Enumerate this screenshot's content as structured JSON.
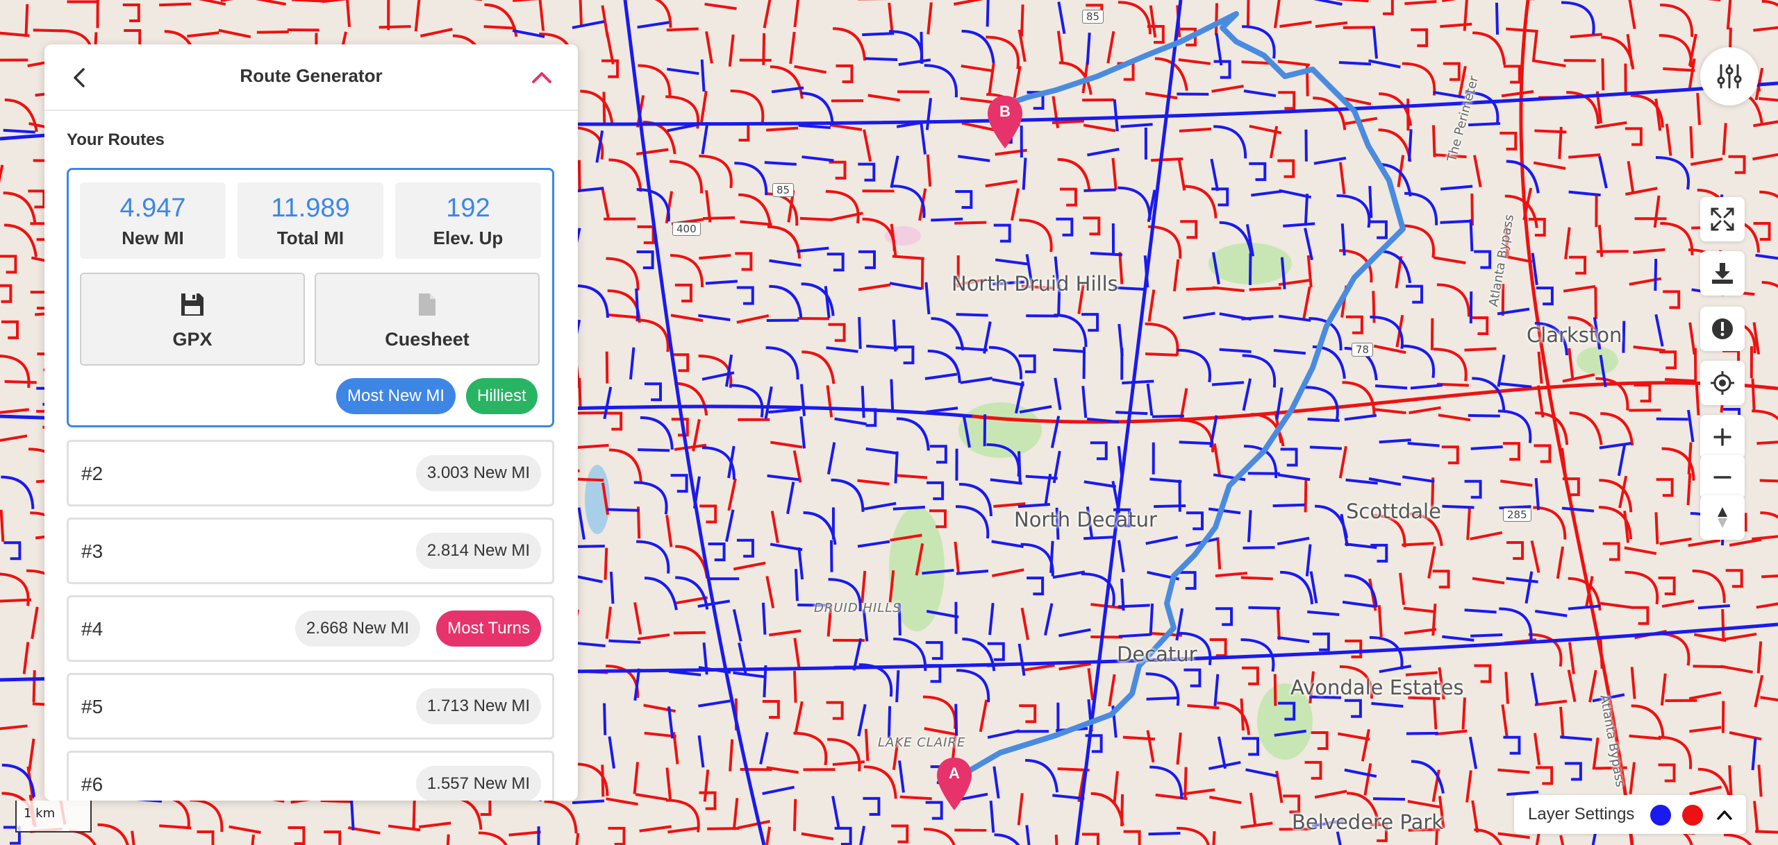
{
  "panel": {
    "title": "Route Generator",
    "routes_heading": "Your Routes",
    "selected_route": {
      "stats": [
        {
          "value": "4.947",
          "label": "New MI"
        },
        {
          "value": "11.989",
          "label": "Total MI"
        },
        {
          "value": "192",
          "label": "Elev. Up"
        }
      ],
      "gpx_label": "GPX",
      "cuesheet_label": "Cuesheet",
      "tags": [
        "Most New MI",
        "Hilliest"
      ]
    },
    "routes": [
      {
        "num": "#2",
        "new_mi": "3.003 New MI",
        "tag": ""
      },
      {
        "num": "#3",
        "new_mi": "2.814 New MI",
        "tag": ""
      },
      {
        "num": "#4",
        "new_mi": "2.668 New MI",
        "tag": "Most Turns"
      },
      {
        "num": "#5",
        "new_mi": "1.713 New MI",
        "tag": ""
      },
      {
        "num": "#6",
        "new_mi": "1.557 New MI",
        "tag": ""
      }
    ]
  },
  "map": {
    "places": [
      "North Druid Hills",
      "North Decatur",
      "Decatur",
      "Scottdale",
      "Clarkston",
      "Avondale Estates",
      "Belvedere Park"
    ],
    "small_places": [
      "DRUID HILLS",
      "LAKE CLAIRE"
    ],
    "roads": [
      "The Perimeter",
      "Atlanta Bypass",
      "Atlanta Bypass"
    ],
    "shields": [
      "85",
      "85",
      "400",
      "78",
      "285"
    ],
    "marker_a": "A",
    "marker_b": "B",
    "scale": "1 km"
  },
  "layer_settings": {
    "label": "Layer Settings"
  },
  "colors": {
    "accent_blue": "#3d86e6",
    "green": "#28b463",
    "pink": "#e6336b",
    "new_street_red": "#ee1111",
    "done_street_blue": "#1a1aee",
    "route_line": "#4a8be0"
  },
  "icons": [
    "back-icon",
    "chevron-up-icon",
    "save-icon",
    "document-icon",
    "sliders-icon",
    "fullscreen-icon",
    "download-icon",
    "alert-icon",
    "locate-icon",
    "plus-icon",
    "minus-icon",
    "compass-icon"
  ]
}
